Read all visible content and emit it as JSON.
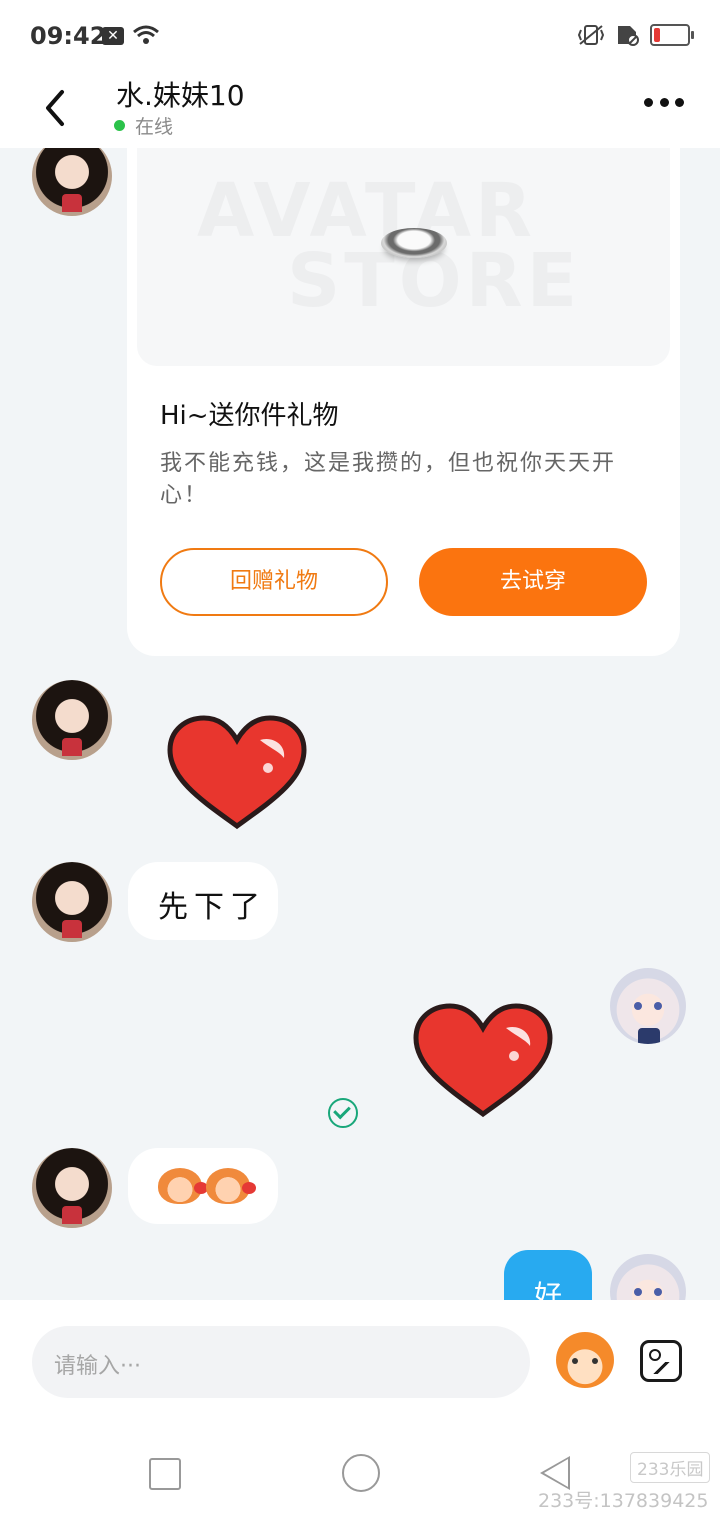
{
  "status_bar": {
    "time": "09:42",
    "notification_icon": "x-icon",
    "icons": [
      "wifi-icon",
      "vibrate-icon",
      "sim-off-icon",
      "battery-low-icon"
    ],
    "battery_color": "#e53935"
  },
  "header": {
    "title": "水.妹妹10",
    "status": "在线",
    "status_color": "#2bc24a"
  },
  "gift_card": {
    "watermark_line1": "AVATAR",
    "watermark_line2": "STORE",
    "title": "Hi~送你件礼物",
    "description": "我不能充钱，这是我攒的，但也祝你天天开心！",
    "return_gift_label": "回赠礼物",
    "try_on_label": "去试穿",
    "accent_color": "#fb740f"
  },
  "messages": [
    {
      "from": "contact",
      "type": "gift-card"
    },
    {
      "from": "contact",
      "type": "sticker",
      "sticker": "red-heart"
    },
    {
      "from": "contact",
      "type": "text",
      "text": "先下了"
    },
    {
      "from": "me",
      "type": "sticker",
      "sticker": "red-heart",
      "status": "sent"
    },
    {
      "from": "contact",
      "type": "emoji",
      "emoji": [
        "kiss-emoji",
        "kiss-emoji"
      ]
    },
    {
      "from": "me",
      "type": "text",
      "text": "好"
    }
  ],
  "input": {
    "placeholder": "请输入···"
  },
  "watermark": {
    "logo": "233乐园",
    "id_text": "233号:137839425"
  }
}
